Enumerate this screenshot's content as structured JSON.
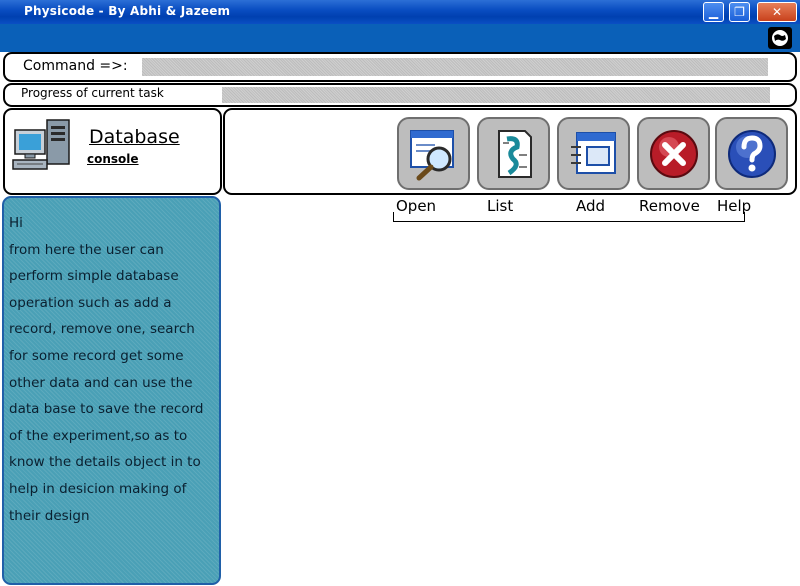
{
  "window": {
    "title": "Physicode - By Abhi & Jazeem",
    "min_glyph": "▁",
    "max_glyph": "❐",
    "close_glyph": "✕"
  },
  "command": {
    "label": "Command =>:",
    "value": ""
  },
  "progress": {
    "label": "Progress of current task",
    "percent": 0
  },
  "db": {
    "title": "Database",
    "subtitle": "console",
    "icon": "computer-database-icon"
  },
  "toolbar": {
    "buttons": [
      {
        "label": "Open",
        "icon": "open-magnifier-icon"
      },
      {
        "label": "List",
        "icon": "list-document-icon"
      },
      {
        "label": "Add",
        "icon": "add-window-icon"
      },
      {
        "label": "Remove",
        "icon": "remove-x-icon"
      },
      {
        "label": "Help",
        "icon": "help-question-icon"
      }
    ]
  },
  "info": {
    "lines": [
      "Hi",
      "from here the user can",
      "perform simple database",
      "operation such as add a",
      "record, remove one, search",
      "for some record get some",
      "other data and can use the",
      "data base to save the record",
      "of the experiment,so as to",
      "know the details object in to",
      "help in desicion making of",
      "their design"
    ]
  },
  "colors": {
    "titlebar": "#0a4ec2",
    "strip": "#0a60b8",
    "info_panel": "#4aa0b6",
    "button_bg": "#bdbdbd"
  }
}
